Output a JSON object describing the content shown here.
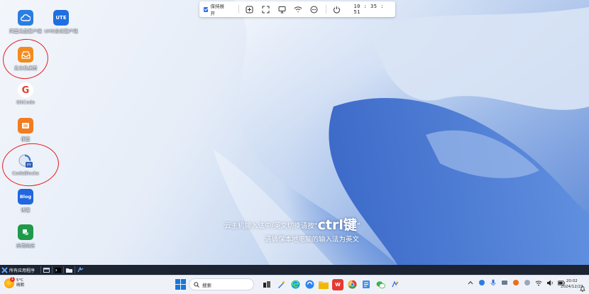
{
  "desktop": {
    "icons": [
      {
        "id": "cloud-app",
        "label": "阿里云盘客户端",
        "color": "#2a7de1",
        "glyph": "☁"
      },
      {
        "id": "ume-app",
        "label": "UME会议客户端",
        "color": "#1f6fe0",
        "glyph": "UTE"
      },
      {
        "id": "remote-desktop",
        "label": "云主机桌面",
        "color": "#f28b1e",
        "glyph": "✉"
      },
      {
        "id": "gitcode",
        "label": "GitCode",
        "color": "#e63b2e",
        "glyph": "G"
      },
      {
        "id": "notes",
        "label": "便签",
        "color": "#f27c1e",
        "glyph": "▤"
      },
      {
        "id": "codeblocks",
        "label": "CodeBlocks",
        "color": "#e8eef8",
        "glyph": "PY"
      },
      {
        "id": "blog",
        "label": "博客",
        "color": "#2266e0",
        "glyph": "Blog"
      },
      {
        "id": "store",
        "label": "应用商店",
        "color": "#1f9a4a",
        "glyph": "A"
      }
    ]
  },
  "toolbar": {
    "keep_expanded_label": "保持展开",
    "keep_expanded_checked": true,
    "clock": "10 : 35 : 51"
  },
  "hint": {
    "line1_prefix": "云主机输入法中/英文切换请按“",
    "line1_key": "ctrl键",
    "line1_suffix": "”",
    "line2": "请确保本地电脑的输入法为英文"
  },
  "remote_taskbar": {
    "start_label": "所有应用程序"
  },
  "taskbar": {
    "weather_temp": "5°C",
    "weather_desc": "晴朗",
    "weather_badge": "1",
    "search_placeholder": "搜索",
    "time": "20:02",
    "date": "2024/12/23"
  },
  "colors": {
    "accent": "#1976d8",
    "annotation": "#e21e1e"
  }
}
